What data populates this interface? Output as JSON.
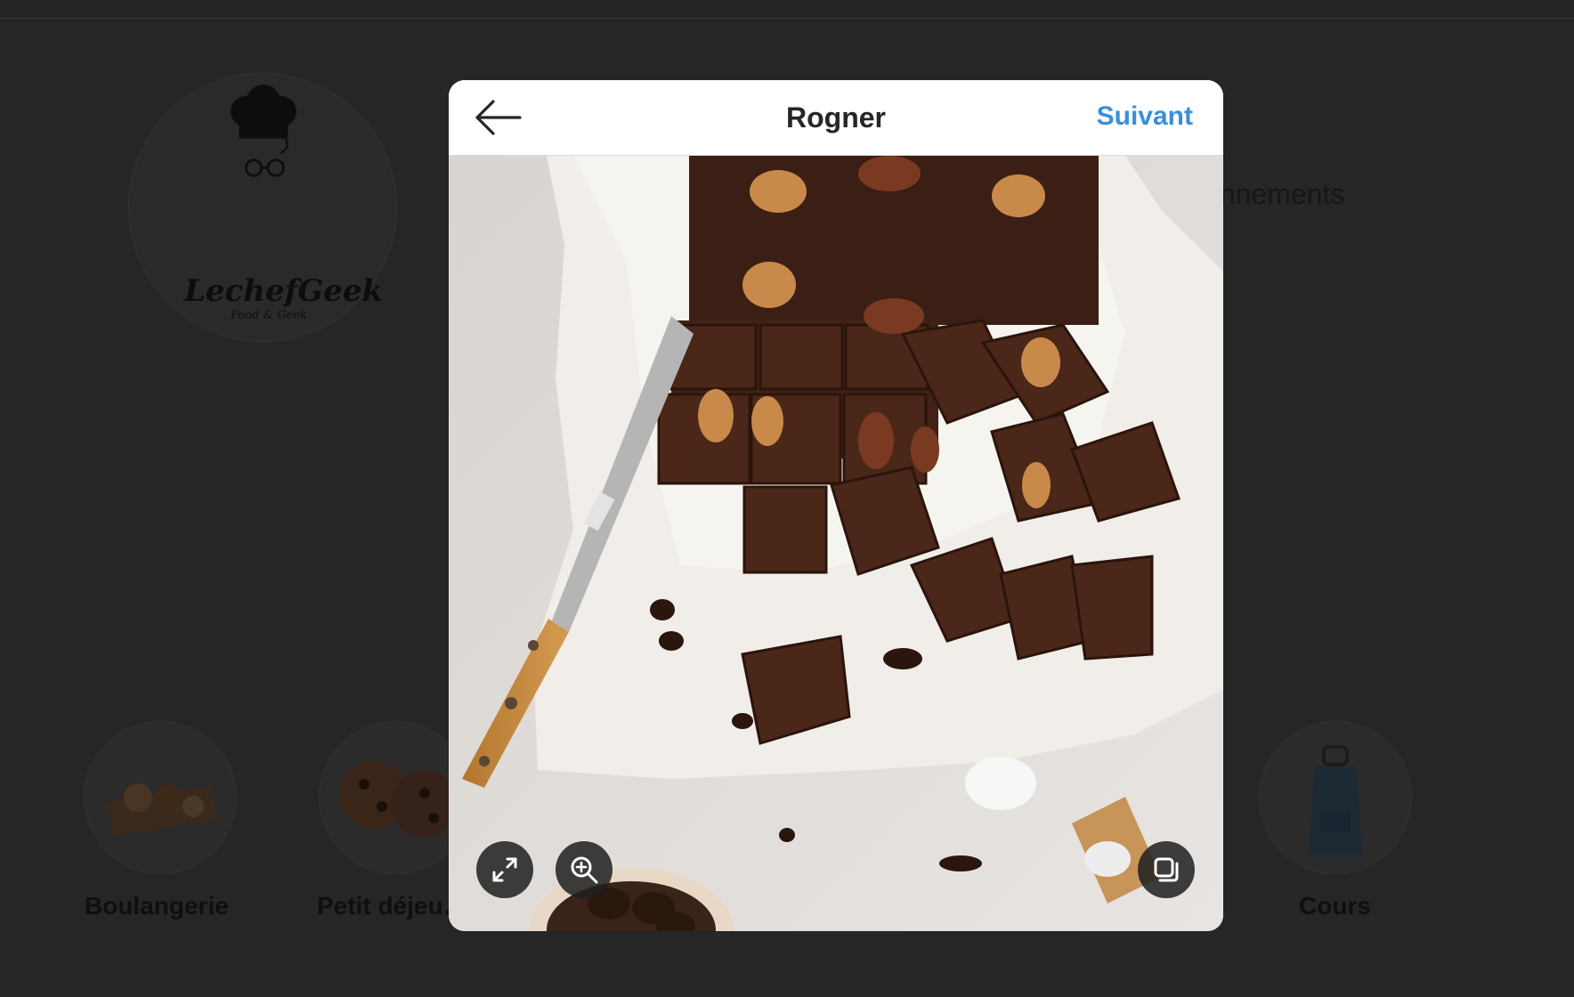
{
  "background": {
    "logo": {
      "title": "LechefGeek",
      "subtitle": "Food & Geek"
    },
    "stat_fragment": "onnements",
    "highlights": [
      {
        "label": "Boulangerie"
      },
      {
        "label": "Petit déjeu…"
      },
      {
        "label": "Cours"
      }
    ]
  },
  "modal": {
    "title": "Rogner",
    "next_label": "Suivant",
    "icons": {
      "back": "arrow-left-icon",
      "expand": "expand-icon",
      "zoom": "zoom-in-icon",
      "multi": "select-multiple-icon"
    },
    "photo": {
      "subject": "brownies"
    }
  },
  "colors": {
    "overlay": "#262626",
    "accent": "#3b8ed8",
    "title": "#262626"
  }
}
